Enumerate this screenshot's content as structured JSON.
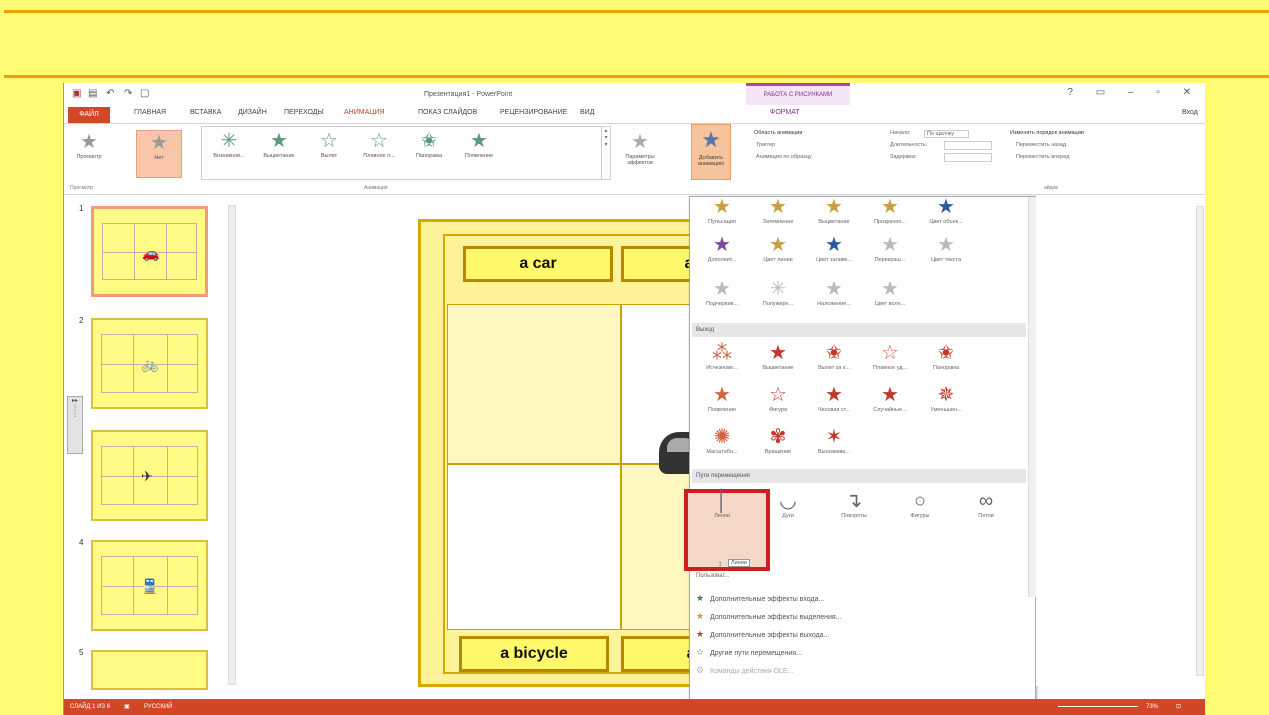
{
  "window": {
    "title": "Презентация1 - PowerPoint",
    "context_tab_header": "РАБОТА С РИСУНКАМИ",
    "controls": "? ▭ – ▫ ✕",
    "signin": "Вход"
  },
  "tabs": [
    "ФАЙЛ",
    "ГЛАВНАЯ",
    "ВСТАВКА",
    "ДИЗАЙН",
    "ПЕРЕХОДЫ",
    "АНИМАЦИЯ",
    "ПОКАЗ СЛАЙДОВ",
    "РЕЦЕНЗИРОВАНИЕ",
    "ВИД",
    "ФОРМАТ"
  ],
  "ribbon": {
    "preview": "Просмотр",
    "none": "Нет",
    "gallery": [
      "Возникнов...",
      "Выцветание",
      "Вылет",
      "Плавное п...",
      "Панорама",
      "Появление"
    ],
    "effect_options": "Параметры эффектов",
    "add_animation": "Добавить анимацию",
    "animation_pane": "Область анимации",
    "trigger": "Триггер",
    "anim_painter": "Анимация по образцу",
    "start_label": "Начало:",
    "start_value": "По щелчку",
    "duration_label": "Длительность:",
    "delay_label": "Задержка:",
    "reorder_title": "Изменить порядок анимации",
    "move_earlier": "Переместить назад",
    "move_later": "Переместить вперед",
    "group_preview": "Просмотр",
    "group_animation": "Анимация",
    "group_slides": "айдов"
  },
  "thumbnails": [
    {
      "num": "1",
      "icon": "car"
    },
    {
      "num": "2",
      "icon": "bicycle"
    },
    {
      "num": "3",
      "icon": "plane"
    },
    {
      "num": "4",
      "icon": "train"
    },
    {
      "num": "5",
      "icon": ""
    }
  ],
  "slide": {
    "label_top_left": "a car",
    "label_top_right": "a p",
    "label_bottom_left": "a bicycle",
    "label_bottom_right": "a t"
  },
  "dropdown": {
    "emphasis_row1": [
      "Пульсация",
      "Затемнение",
      "Выцветание",
      "Прозрачно...",
      "Цвет объек..."
    ],
    "emphasis_row2": [
      "Дополнит...",
      "Цвет линии",
      "Цвет заливк...",
      "Перекраш...",
      "Цвет текста"
    ],
    "emphasis_row3": [
      "Подчеркив...",
      "Полужирн...",
      "Наложение...",
      "Цвет волн..."
    ],
    "exit_title": "Выход",
    "exit_row1": [
      "Исчезнове...",
      "Выцветание",
      "Вылет за к...",
      "Плавное уд...",
      "Панорама"
    ],
    "exit_row2": [
      "Появление",
      "Фигура",
      "Часовая ст...",
      "Случайные...",
      "Уменьшен..."
    ],
    "exit_row3": [
      "Масштабн...",
      "Вращение",
      "Выскакива..."
    ],
    "motion_title": "Пути перемещения",
    "motion": [
      "Линии",
      "Дуги",
      "Повороты",
      "Фигуры",
      "Петли"
    ],
    "tooltip": "Линии",
    "custom": "Пользоват...",
    "more": [
      "Дополнительные эффекты входа...",
      "Дополнительные эффекты выделения...",
      "Дополнительные эффекты выхода...",
      "Другие пути перемещения...",
      "Команды действия OLE..."
    ]
  },
  "status": {
    "slide": "СЛАЙД 1 ИЗ 6",
    "lang": "РУССКИЙ",
    "zoom": "73%"
  }
}
